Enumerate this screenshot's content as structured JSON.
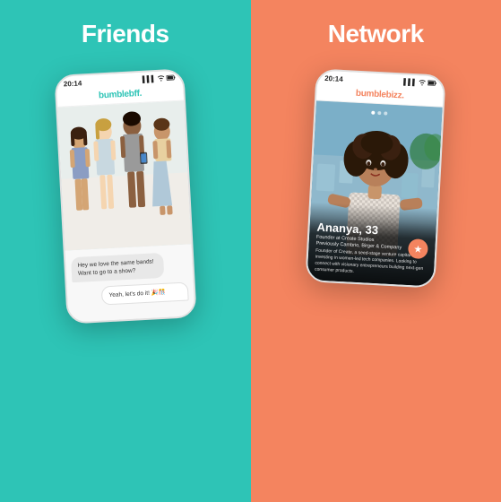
{
  "panels": {
    "friends": {
      "title": "Friends",
      "bg_color": "#2ec4b6",
      "phone": {
        "status_time": "20:14",
        "app_name": "bumblebff.",
        "chat_left": "Hey we love the same bands! Want to go to a show?",
        "chat_right": "Yeah, let's do it! 🎉🎊"
      }
    },
    "network": {
      "title": "Network",
      "bg_color": "#f4845f",
      "phone": {
        "status_time": "20:14",
        "app_name": "bumblebizz.",
        "profile_name": "Ananya, 33",
        "profile_tagline": "Founder at Create Studios",
        "profile_sub": "Previously Cambrio, Birger & Company",
        "profile_bio": "Founder of Create, a seed-stage venture capital fund investing in women-led tech companies. Looking to connect with visionary entrepreneurs building next-gen consumer products."
      }
    }
  },
  "icons": {
    "signal": "▌▌▌",
    "wifi": "WiFi",
    "battery": "▮"
  }
}
